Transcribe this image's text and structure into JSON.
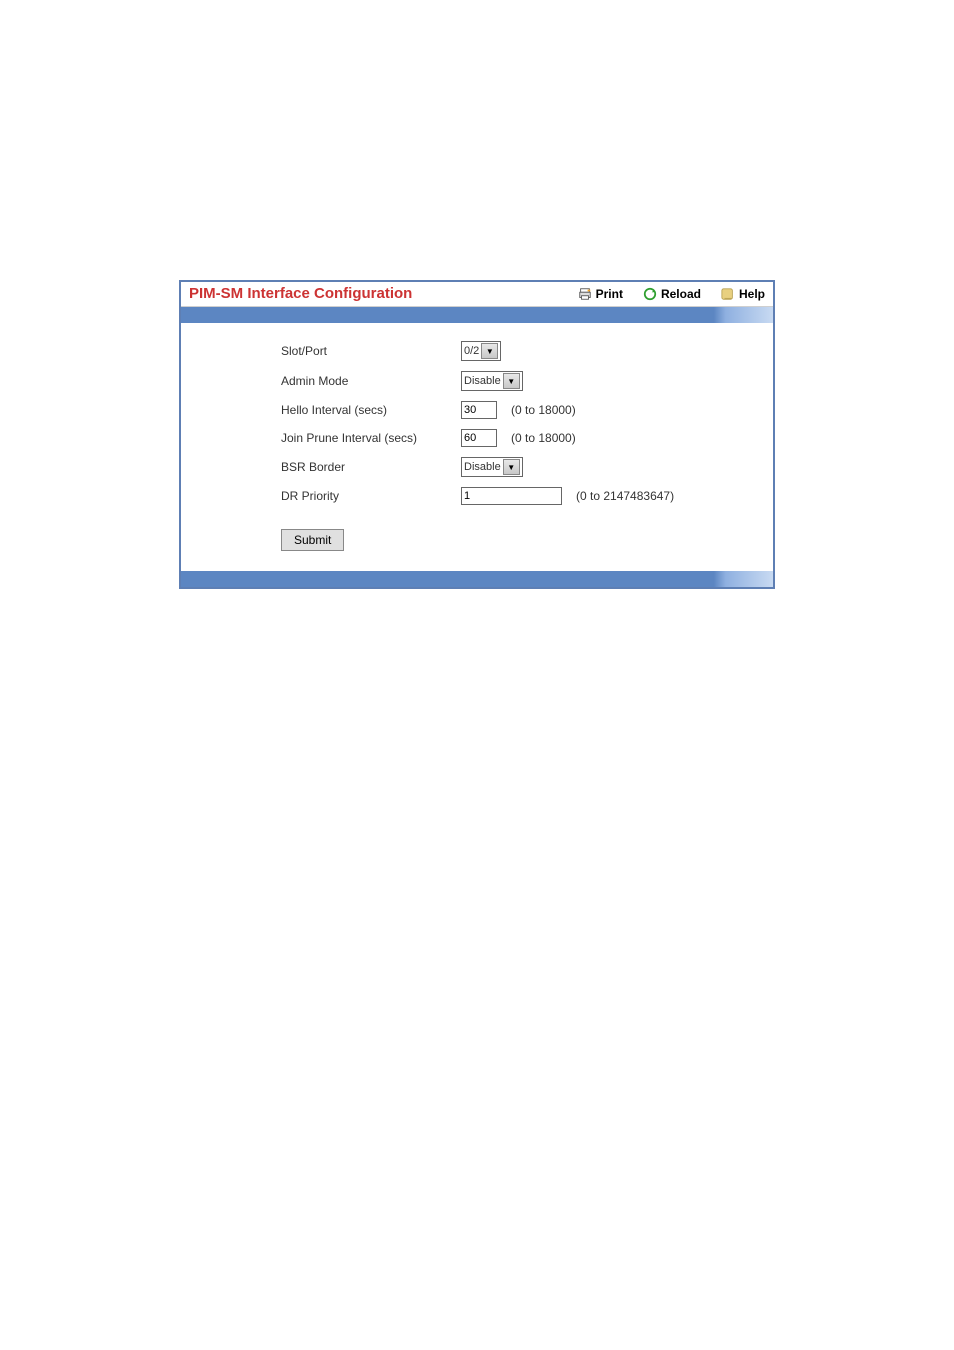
{
  "header": {
    "title": "PIM-SM Interface Configuration",
    "actions": {
      "print": "Print",
      "reload": "Reload",
      "help": "Help"
    }
  },
  "form": {
    "slot_port": {
      "label": "Slot/Port",
      "value": "0/2"
    },
    "admin_mode": {
      "label": "Admin Mode",
      "value": "Disable"
    },
    "hello_interval": {
      "label": "Hello Interval (secs)",
      "value": "30",
      "hint": "(0 to 18000)"
    },
    "join_prune_interval": {
      "label": "Join Prune Interval (secs)",
      "value": "60",
      "hint": "(0 to 18000)"
    },
    "bsr_border": {
      "label": "BSR Border",
      "value": "Disable"
    },
    "dr_priority": {
      "label": "DR Priority",
      "value": "1",
      "hint": "(0 to 2147483647)"
    },
    "submit_label": "Submit"
  }
}
